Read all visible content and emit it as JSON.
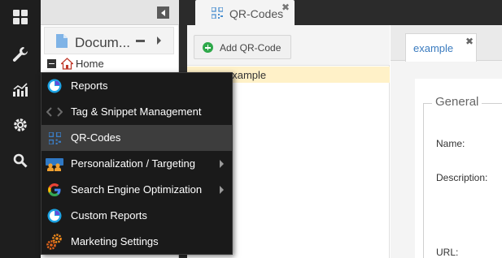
{
  "colors": {
    "accent_blue": "#3a7bbf",
    "menu_bg": "#1a1a1a",
    "menu_active": "#3d3d3d",
    "selected_row": "#fff1c8",
    "add_green": "#2ea84a"
  },
  "left_bar": {
    "icons": [
      "dashboard-grid-icon",
      "wrench-icon",
      "analytics-chart-icon",
      "gear-icon",
      "search-icon"
    ]
  },
  "tree": {
    "documents_label": "Docum...",
    "home_label": "Home"
  },
  "tabs": [
    {
      "label": "QR-Codes",
      "close": "✖"
    }
  ],
  "list": {
    "add_button_label": "Add QR-Code",
    "rows": [
      {
        "label": "example"
      }
    ]
  },
  "detail": {
    "tab_label": "example",
    "tab_close": "✖",
    "group_title": "General",
    "fields": [
      {
        "label": "Name:"
      },
      {
        "label": "Description:"
      },
      {
        "label": "URL:"
      }
    ]
  },
  "menu": {
    "items": [
      {
        "label": "Reports",
        "icon": "reports-icon",
        "submenu": false,
        "active": false
      },
      {
        "label": "Tag & Snippet Management",
        "icon": "code-brackets-icon",
        "submenu": false,
        "active": false
      },
      {
        "label": "QR-Codes",
        "icon": "qr-code-icon",
        "submenu": false,
        "active": true
      },
      {
        "label": "Personalization / Targeting",
        "icon": "people-target-icon",
        "submenu": true,
        "active": false
      },
      {
        "label": "Search Engine Optimization",
        "icon": "google-g-icon",
        "submenu": true,
        "active": false
      },
      {
        "label": "Custom Reports",
        "icon": "custom-reports-icon",
        "submenu": false,
        "active": false
      },
      {
        "label": "Marketing Settings",
        "icon": "marketing-gears-icon",
        "submenu": false,
        "active": false
      }
    ]
  }
}
